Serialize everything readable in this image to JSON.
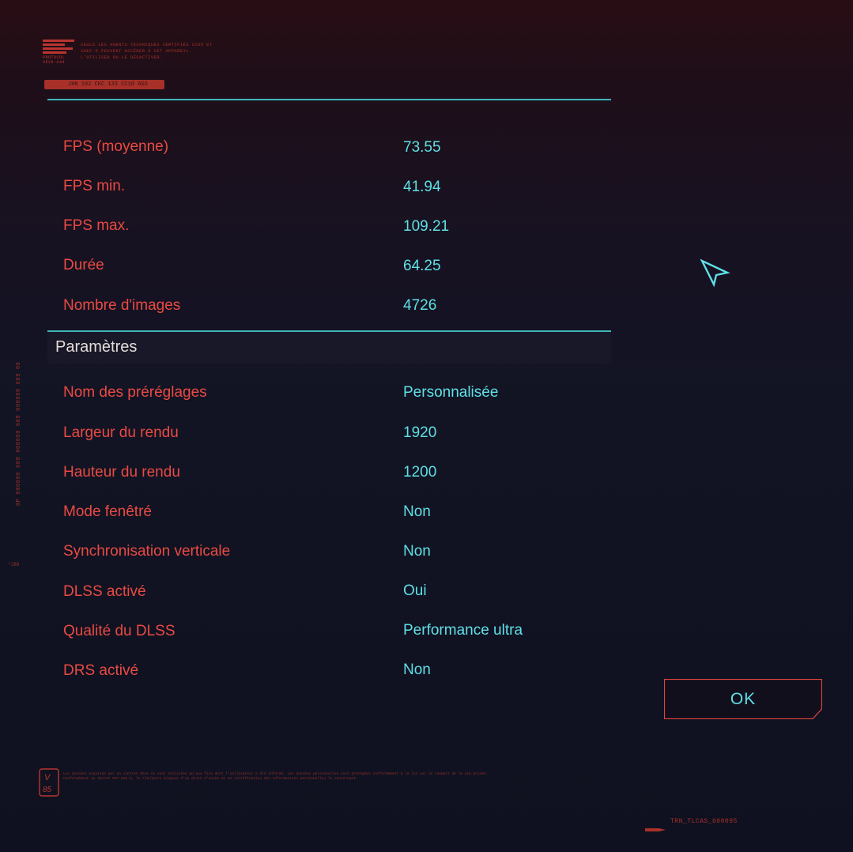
{
  "header": {
    "logo_text": "PROTOCOL 4526-A44",
    "legal_text": "SEULS LES AGENTS TECHNIQUES CERTIFIÉS CC05 ET SHEF-5 PEUVENT ACCÉDER À CET APPAREIL. L'UTILISER OU LE DÉSACTIVER.",
    "code_tag": "JHN 102 CKC 133 CC10 ASS"
  },
  "benchmark": {
    "rows": [
      {
        "label": "FPS (moyenne)",
        "value": "73.55"
      },
      {
        "label": "FPS min.",
        "value": "41.94"
      },
      {
        "label": "FPS max.",
        "value": "109.21"
      },
      {
        "label": "Durée",
        "value": "64.25"
      },
      {
        "label": "Nombre d'images",
        "value": "4726"
      }
    ]
  },
  "settings": {
    "title": "Paramètres",
    "rows": [
      {
        "label": "Nom des préréglages",
        "value": "Personnalisée"
      },
      {
        "label": "Largeur du rendu",
        "value": "1920"
      },
      {
        "label": "Hauteur du rendu",
        "value": "1200"
      },
      {
        "label": "Mode fenêtré",
        "value": "Non"
      },
      {
        "label": "Synchronisation verticale",
        "value": "Non"
      },
      {
        "label": "DLSS activé",
        "value": "Oui"
      },
      {
        "label": "Qualité du DLSS",
        "value": "Performance ultra"
      },
      {
        "label": "DRS activé",
        "value": "Non"
      }
    ]
  },
  "side": {
    "vertical_code": "0P 000000 689 000000 689 000000 689 00",
    "mark": "*J89"
  },
  "actions": {
    "ok_label": "OK"
  },
  "footer": {
    "badge_text": "V 85",
    "legal_text": "Les données acquises par un contrat NCAA ne sont utilisées qu'aux fins dont l'utilisateur a été informé. Les données personnelles sont protégées conformément à la loi sur le respect de la vie privée. Conformément au décret 997.041-0, le titulaire dispose d'un droit d'accès et de rectification des informations personnelles le concernant.",
    "code": "TRN_TLCAS_600095"
  },
  "colors": {
    "label": "#ea4a42",
    "value": "#5fe0e6",
    "rule": "#3fb6b9",
    "accent_red": "#a73029"
  },
  "icons": {
    "cursor": "pointer-arrow-icon"
  }
}
